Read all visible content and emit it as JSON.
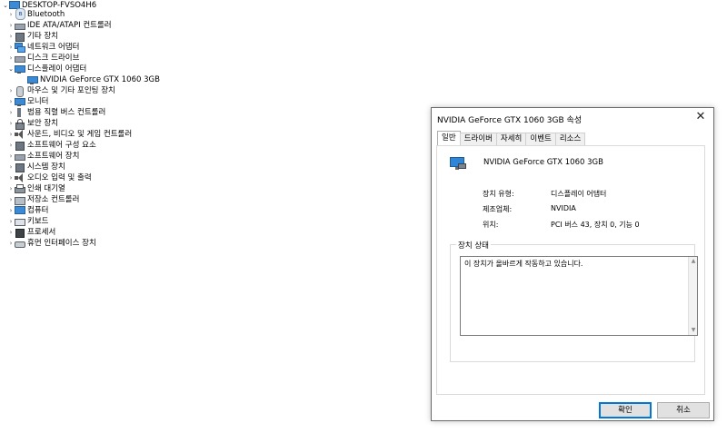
{
  "tree": {
    "root": {
      "label": "DESKTOP-FVSO4H6",
      "icon": "computer-icon"
    },
    "items": [
      {
        "label": "Bluetooth",
        "icon": "bluetooth-icon",
        "expanded": false
      },
      {
        "label": "IDE ATA/ATAPI 컨트롤러",
        "icon": "controller-icon",
        "expanded": false
      },
      {
        "label": "기타 장치",
        "icon": "unknown-device-icon",
        "expanded": false
      },
      {
        "label": "네트워크 어댑터",
        "icon": "network-adapter-icon",
        "expanded": false
      },
      {
        "label": "디스크 드라이브",
        "icon": "disk-drive-icon",
        "expanded": false
      },
      {
        "label": "디스플레이 어댑터",
        "icon": "display-adapter-icon",
        "expanded": true
      },
      {
        "label": "NVIDIA GeForce GTX 1060 3GB",
        "icon": "display-adapter-icon",
        "child": true
      },
      {
        "label": "마우스 및 기타 포인팅 장치",
        "icon": "mouse-icon",
        "expanded": false
      },
      {
        "label": "모니터",
        "icon": "monitor-icon",
        "expanded": false
      },
      {
        "label": "범용 직렬 버스 컨트롤러",
        "icon": "usb-icon",
        "expanded": false
      },
      {
        "label": "보안 장치",
        "icon": "security-device-icon",
        "expanded": false
      },
      {
        "label": "사운드, 비디오 및 게임 컨트롤러",
        "icon": "speaker-icon",
        "expanded": false
      },
      {
        "label": "소프트웨어 구성 요소",
        "icon": "software-component-icon",
        "expanded": false
      },
      {
        "label": "소프트웨어 장치",
        "icon": "software-device-icon",
        "expanded": false
      },
      {
        "label": "시스템 장치",
        "icon": "system-device-icon",
        "expanded": false
      },
      {
        "label": "오디오 입력 및 출력",
        "icon": "audio-icon",
        "expanded": false
      },
      {
        "label": "인쇄 대기열",
        "icon": "printer-icon",
        "expanded": false
      },
      {
        "label": "저장소 컨트롤러",
        "icon": "storage-controller-icon",
        "expanded": false
      },
      {
        "label": "컴퓨터",
        "icon": "computer-icon",
        "expanded": false
      },
      {
        "label": "키보드",
        "icon": "keyboard-icon",
        "expanded": false
      },
      {
        "label": "프로세서",
        "icon": "processor-icon",
        "expanded": false
      },
      {
        "label": "휴먼 인터페이스 장치",
        "icon": "hid-icon",
        "expanded": false
      }
    ]
  },
  "dialog": {
    "title": "NVIDIA GeForce GTX 1060 3GB 속성",
    "close_symbol": "✕",
    "tabs": [
      {
        "label": "일반",
        "active": true
      },
      {
        "label": "드라이버",
        "active": false
      },
      {
        "label": "자세히",
        "active": false
      },
      {
        "label": "이벤트",
        "active": false
      },
      {
        "label": "리소스",
        "active": false
      }
    ],
    "device_name": "NVIDIA GeForce GTX 1060 3GB",
    "props": {
      "type_label": "장치 유형:",
      "type_value": "디스플레이 어댑터",
      "maker_label": "제조업체:",
      "maker_value": "NVIDIA",
      "location_label": "위치:",
      "location_value": "PCI 버스 43, 장치 0, 기능 0"
    },
    "status_group_title": "장치 상태",
    "status_text": "이 장치가 올바르게 작동하고 있습니다.",
    "ok_label": "확인",
    "cancel_label": "취소"
  },
  "colors": {
    "accent": "#0078d7",
    "button_bg": "#e1e1e1"
  }
}
